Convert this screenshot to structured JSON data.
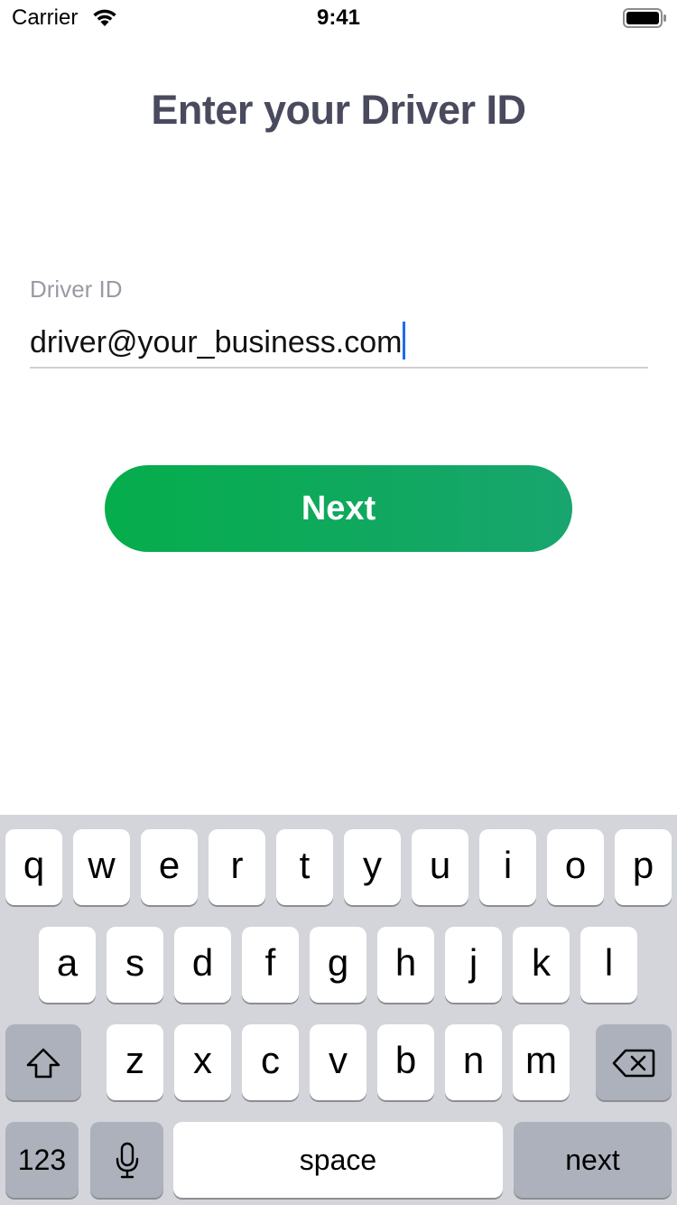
{
  "status_bar": {
    "carrier": "Carrier",
    "time": "9:41",
    "wifi_icon": "wifi-icon",
    "battery_icon": "battery-icon"
  },
  "title": "Enter your Driver ID",
  "field": {
    "label": "Driver ID",
    "value": "driver@your_business.com"
  },
  "next_button": {
    "label": "Next",
    "colors": [
      "#05ad4b",
      "#18a56f"
    ]
  },
  "keyboard": {
    "row1": [
      "q",
      "w",
      "e",
      "r",
      "t",
      "y",
      "u",
      "i",
      "o",
      "p"
    ],
    "row2": [
      "a",
      "s",
      "d",
      "f",
      "g",
      "h",
      "j",
      "k",
      "l"
    ],
    "row3": [
      "z",
      "x",
      "c",
      "v",
      "b",
      "n",
      "m"
    ],
    "shift_icon": "shift-icon",
    "delete_icon": "delete-icon",
    "numbers_label": "123",
    "mic_icon": "microphone-icon",
    "space_label": "space",
    "return_label": "next",
    "background": "#d3d5db"
  }
}
